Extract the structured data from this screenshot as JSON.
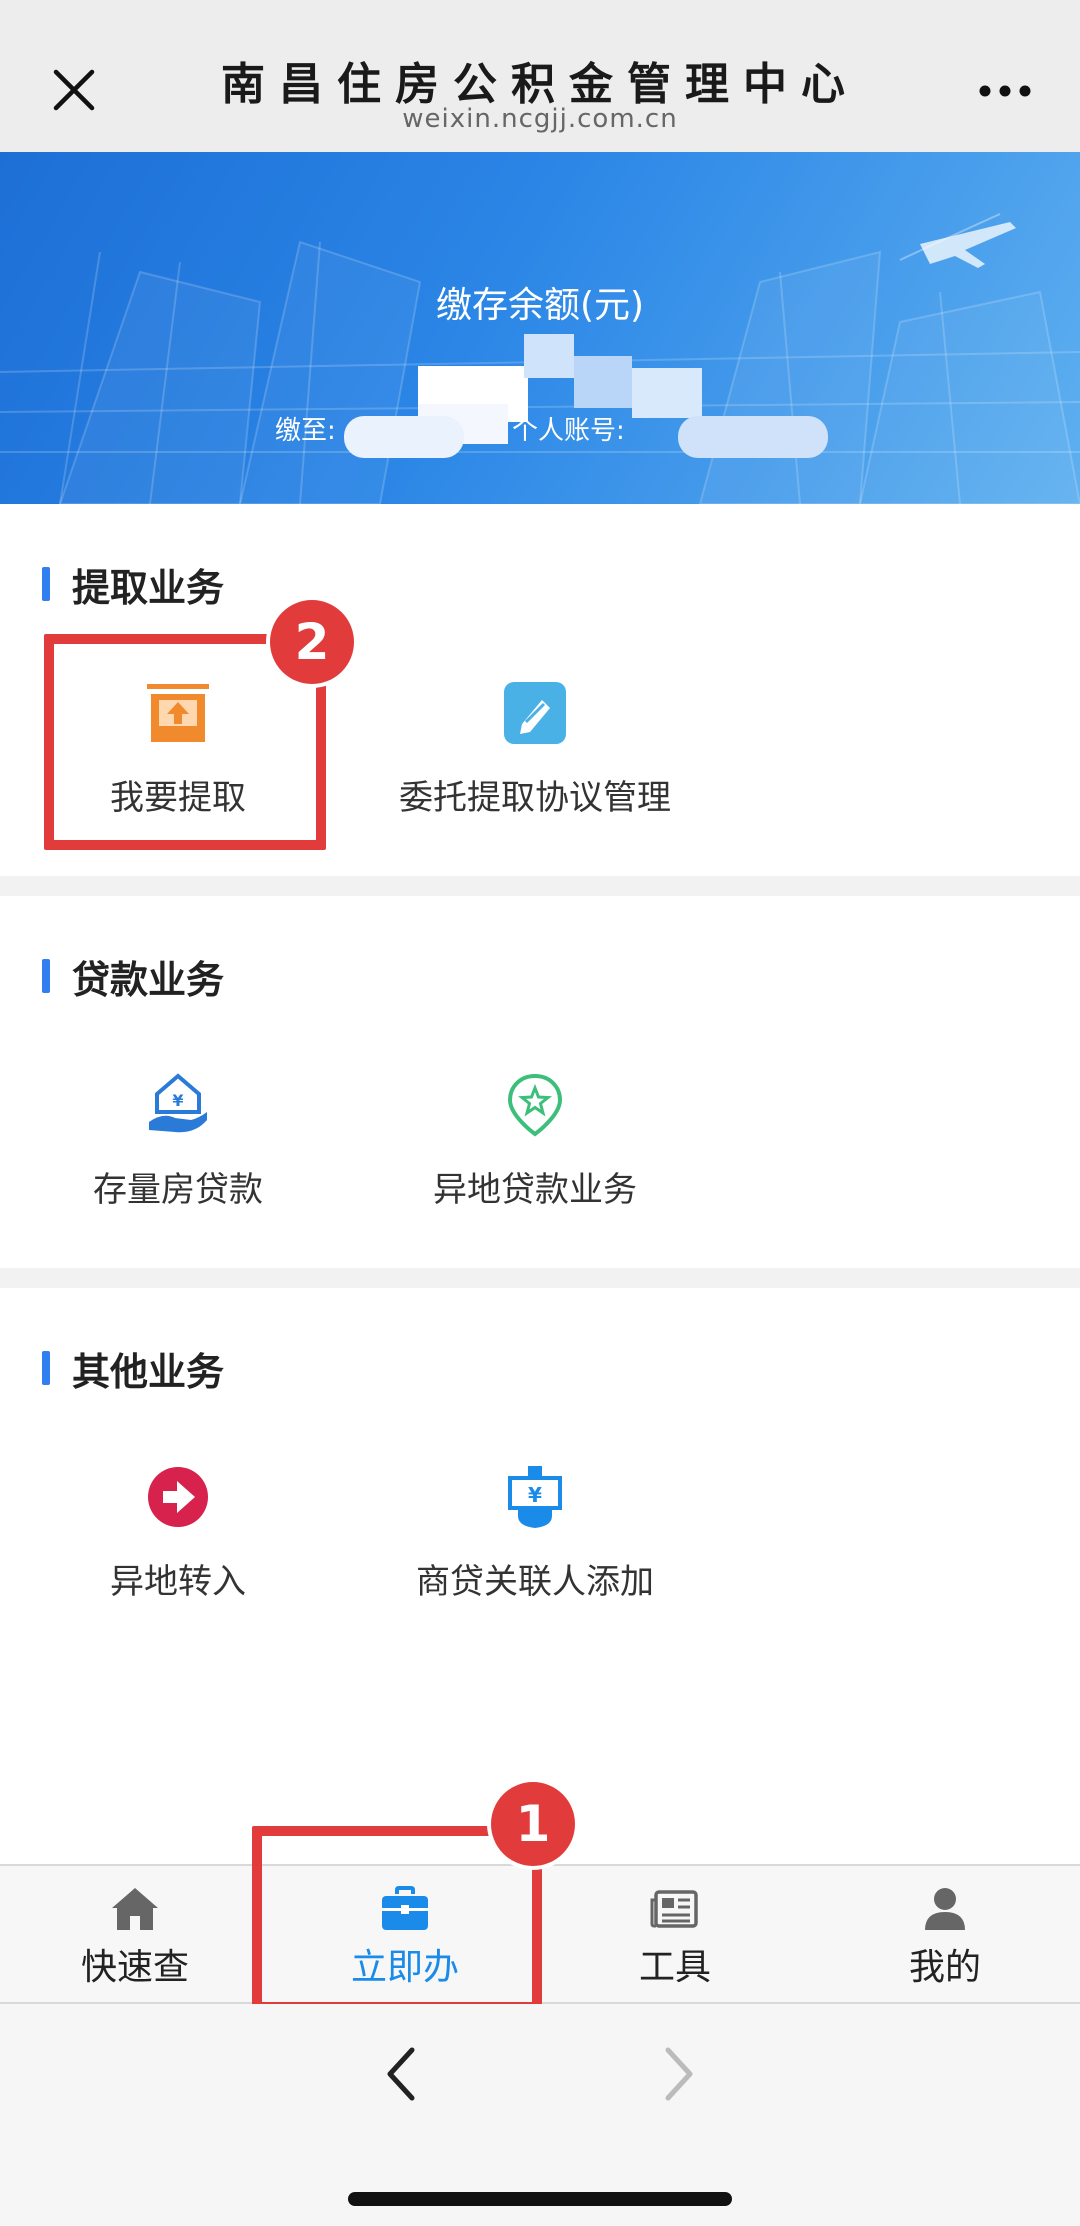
{
  "header": {
    "title": "南昌住房公积金管理中心",
    "url": "weixin.ncgjj.com.cn"
  },
  "banner": {
    "balance_label": "缴存余额(元)",
    "paid_until_label": "缴至:",
    "account_label": "个人账号:"
  },
  "sections": [
    {
      "title": "提取业务",
      "items": [
        {
          "label": "我要提取",
          "icon": "withdraw-icon"
        },
        {
          "label": "委托提取协议管理",
          "icon": "agreement-edit-icon"
        }
      ]
    },
    {
      "title": "贷款业务",
      "items": [
        {
          "label": "存量房贷款",
          "icon": "house-loan-icon"
        },
        {
          "label": "异地贷款业务",
          "icon": "location-star-icon"
        }
      ]
    },
    {
      "title": "其他业务",
      "items": [
        {
          "label": "异地转入",
          "icon": "transfer-in-icon"
        },
        {
          "label": "商贷关联人添加",
          "icon": "commercial-loan-icon"
        }
      ]
    }
  ],
  "annotations": {
    "badge1": "1",
    "badge2": "2",
    "color": "#e23b3b"
  },
  "tabbar": {
    "tabs": [
      {
        "label": "快速查",
        "icon": "home-icon"
      },
      {
        "label": "立即办",
        "icon": "briefcase-icon",
        "active": true
      },
      {
        "label": "工具",
        "icon": "newspaper-icon"
      },
      {
        "label": "我的",
        "icon": "user-icon"
      }
    ],
    "active_color": "#1a8be8"
  }
}
